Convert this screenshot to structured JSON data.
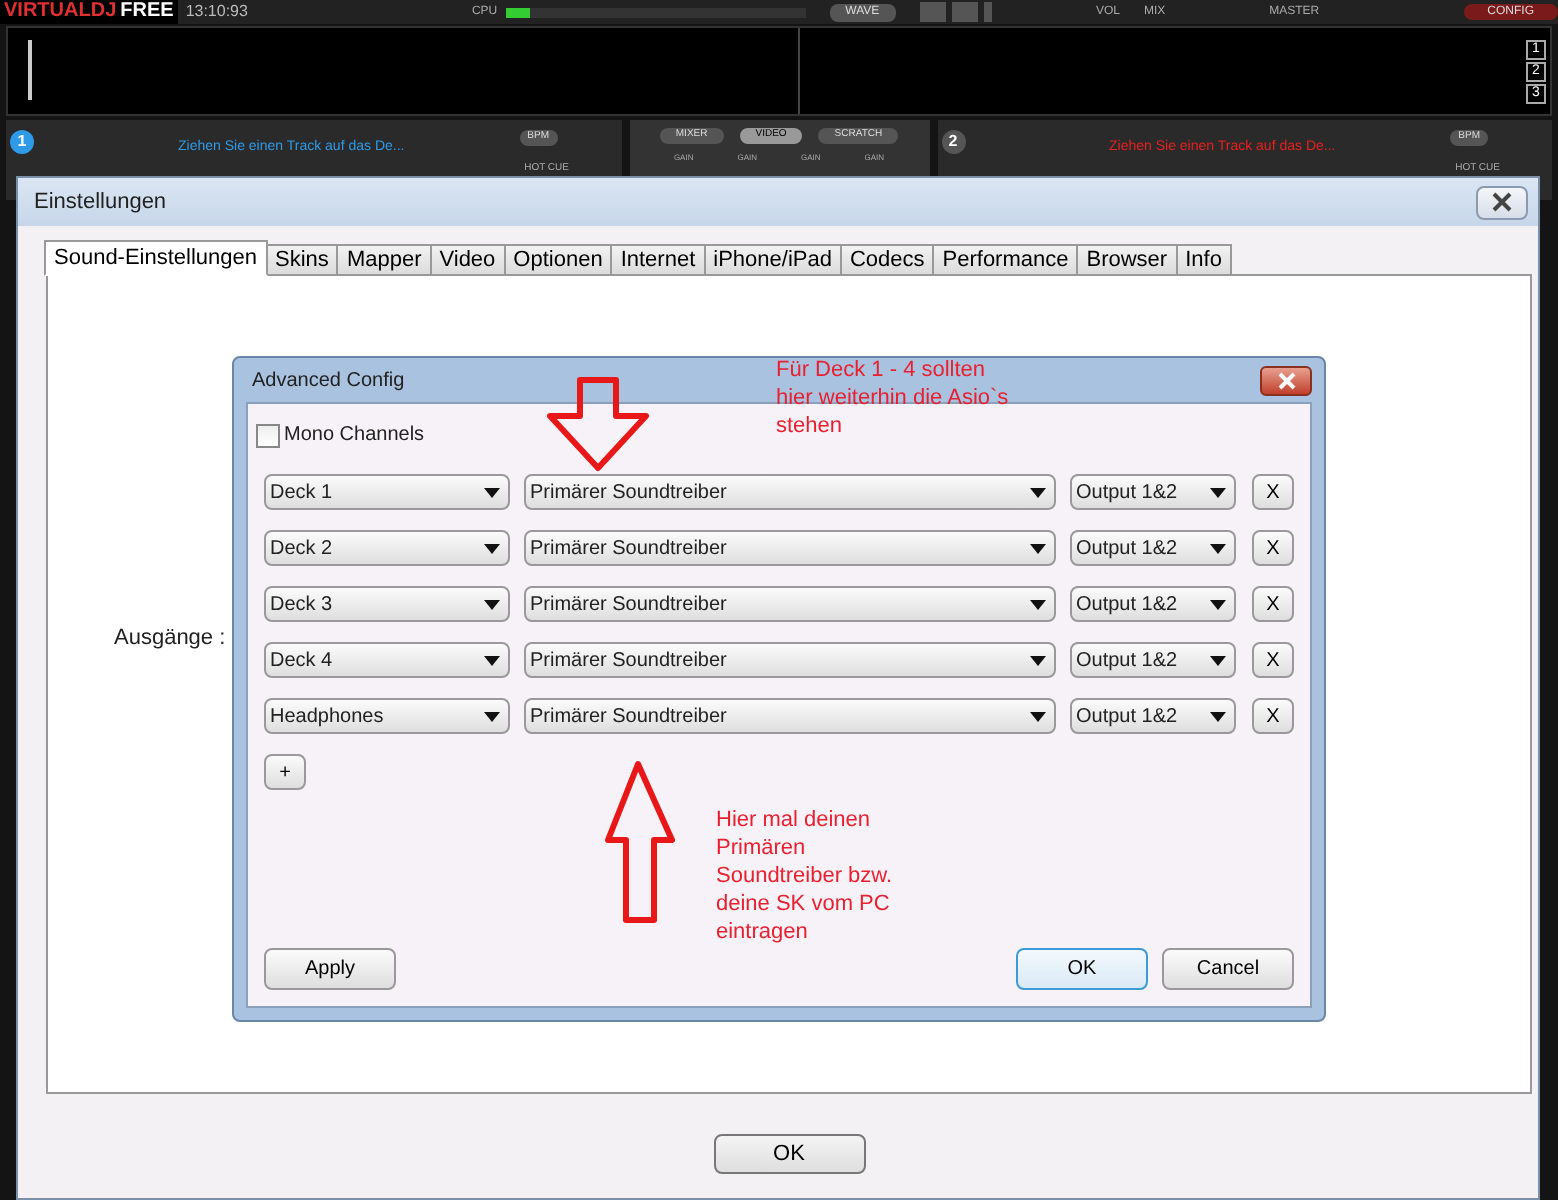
{
  "app": {
    "logo": [
      "VIRTUAL",
      "DJ",
      "FREE"
    ],
    "clock": "13:10:93",
    "cpu_label": "CPU",
    "cpu_meter": {
      "level": 0.08
    },
    "wave_button": "WAVE",
    "vol_label": "VOL",
    "mix_label": "MIX",
    "master_label": "MASTER",
    "config_button": "CONFIG",
    "screen_buttons": [
      "1",
      "2",
      "3"
    ],
    "decks": [
      {
        "number": "1",
        "prompt": "Ziehen Sie einen Track auf das De...",
        "color": "#2f9be8",
        "bpm": "BPM",
        "hot_cue": "HOT CUE"
      },
      {
        "number": "2",
        "prompt": "Ziehen Sie einen Track auf das De...",
        "color": "#e82020",
        "bpm": "BPM",
        "hot_cue": "HOT CUE"
      }
    ],
    "mixer_tabs": [
      {
        "label": "MIXER",
        "selected": false
      },
      {
        "label": "VIDEO",
        "selected": true
      },
      {
        "label": "SCRATCH",
        "selected": false
      }
    ],
    "gain_labels": [
      "GAIN",
      "GAIN",
      "GAIN",
      "GAIN"
    ]
  },
  "settings": {
    "title": "Einstellungen",
    "tabs": [
      {
        "label": "Sound-Einstellungen",
        "selected": true
      },
      {
        "label": "Skins",
        "selected": false
      },
      {
        "label": "Mapper",
        "selected": false
      },
      {
        "label": "Video",
        "selected": false
      },
      {
        "label": "Optionen",
        "selected": false
      },
      {
        "label": "Internet",
        "selected": false
      },
      {
        "label": "iPhone/iPad",
        "selected": false
      },
      {
        "label": "Codecs",
        "selected": false
      },
      {
        "label": "Performance",
        "selected": false
      },
      {
        "label": "Browser",
        "selected": false
      },
      {
        "label": "Info",
        "selected": false
      }
    ],
    "outputs_label": "Ausgänge :",
    "ok_button": "OK"
  },
  "advanced_config": {
    "title": "Advanced Config",
    "mono_channels": {
      "label": "Mono Channels",
      "checked": false
    },
    "rows": [
      {
        "channel": "Deck 1",
        "driver": "Primärer Soundtreiber",
        "output": "Output 1&2",
        "remove": "X"
      },
      {
        "channel": "Deck 2",
        "driver": "Primärer Soundtreiber",
        "output": "Output 1&2",
        "remove": "X"
      },
      {
        "channel": "Deck 3",
        "driver": "Primärer Soundtreiber",
        "output": "Output 1&2",
        "remove": "X"
      },
      {
        "channel": "Deck 4",
        "driver": "Primärer Soundtreiber",
        "output": "Output 1&2",
        "remove": "X"
      },
      {
        "channel": "Headphones",
        "driver": "Primärer Soundtreiber",
        "output": "Output 1&2",
        "remove": "X"
      }
    ],
    "add_button": "+",
    "apply_button": "Apply",
    "ok_button": "OK",
    "cancel_button": "Cancel"
  },
  "annotations": [
    {
      "kind": "down",
      "text": "Für Deck 1 - 4 sollten hier weiterhin die Asio`s stehen"
    },
    {
      "kind": "up",
      "text": "Hier mal deinen Primären Soundtreiber bzw. deine SK vom PC eintragen"
    }
  ]
}
